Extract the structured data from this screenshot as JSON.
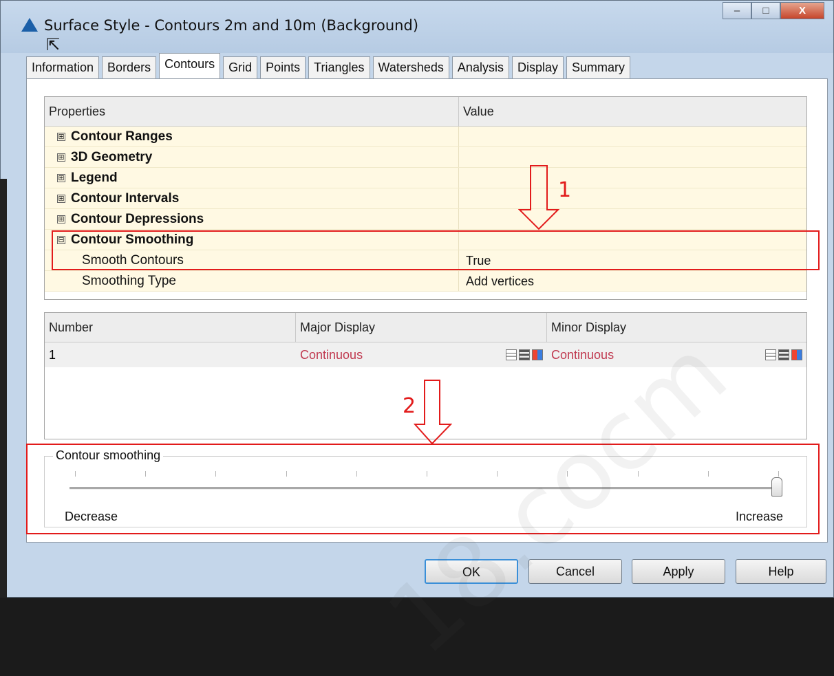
{
  "window": {
    "title": "Surface Style - Contours 2m and 10m (Background)",
    "controls": {
      "minimize": "–",
      "maximize": "□",
      "close": "X"
    }
  },
  "tabs": [
    "Information",
    "Borders",
    "Contours",
    "Grid",
    "Points",
    "Triangles",
    "Watersheds",
    "Analysis",
    "Display",
    "Summary"
  ],
  "active_tab": "Contours",
  "properties": {
    "headers": {
      "properties": "Properties",
      "value": "Value"
    },
    "rows": [
      {
        "label": "Contour Ranges",
        "value": "",
        "expander": "⊞",
        "bold": true
      },
      {
        "label": "3D Geometry",
        "value": "",
        "expander": "⊞",
        "bold": true
      },
      {
        "label": "Legend",
        "value": "",
        "expander": "⊞",
        "bold": true
      },
      {
        "label": "Contour Intervals",
        "value": "",
        "expander": "⊞",
        "bold": true
      },
      {
        "label": "Contour Depressions",
        "value": "",
        "expander": "⊞",
        "bold": true
      },
      {
        "label": "Contour Smoothing",
        "value": "",
        "expander": "⊟",
        "bold": true
      },
      {
        "label": "Smooth Contours",
        "value": "True",
        "expander": "",
        "bold": false
      },
      {
        "label": "Smoothing Type",
        "value": "Add vertices",
        "expander": "",
        "bold": false
      }
    ]
  },
  "display_table": {
    "headers": {
      "number": "Number",
      "major": "Major Display",
      "minor": "Minor Display"
    },
    "rows": [
      {
        "number": "1",
        "major": "Continuous",
        "minor": "Continuous"
      }
    ]
  },
  "smoothing": {
    "group_label": "Contour smoothing",
    "min_label": "Decrease",
    "max_label": "Increase",
    "level": 1.0
  },
  "buttons": {
    "ok": "OK",
    "cancel": "Cancel",
    "apply": "Apply",
    "help": "Help"
  },
  "annotations": {
    "one": "1",
    "two": "2"
  },
  "watermark": "18.cocm",
  "colors": {
    "annotation": "#e21b1b",
    "linetype_text": "#c0394f",
    "property_bg": "#fff9e3"
  }
}
